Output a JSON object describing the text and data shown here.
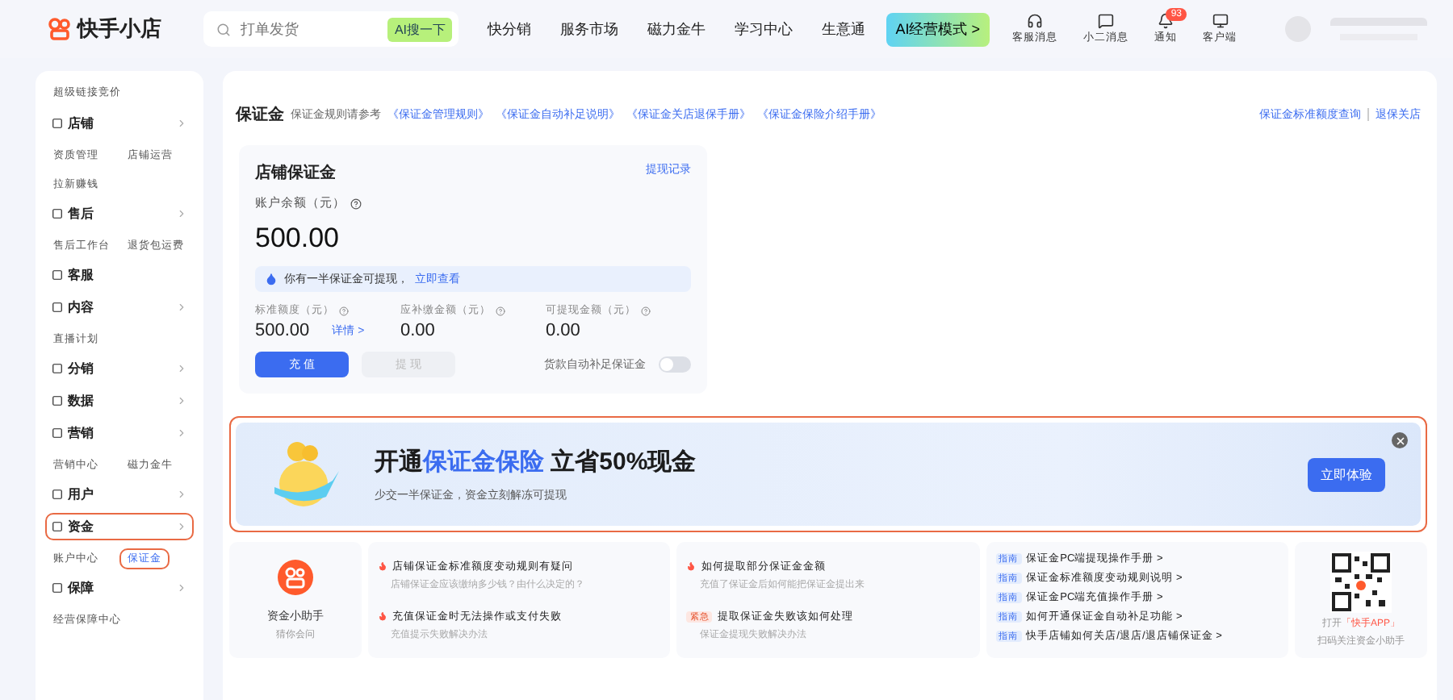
{
  "header": {
    "logo": "快手小店",
    "search": {
      "placeholder": "打单发货",
      "button": "AI搜一下"
    },
    "nav": [
      "快分销",
      "服务市场",
      "磁力金牛",
      "学习中心",
      "生意通"
    ],
    "ai_mode": "AI经营模式 >",
    "tools": [
      {
        "kind": "headset",
        "label": "客服消息"
      },
      {
        "kind": "chat",
        "label": "小二消息"
      },
      {
        "kind": "bell",
        "label": "通知",
        "badge": "93"
      },
      {
        "kind": "monitor",
        "label": "客户端"
      }
    ]
  },
  "sidebar": {
    "top_link": "超级链接竞价",
    "sections": [
      {
        "title": "店铺",
        "highlighted": false,
        "chevron": true,
        "children": [
          {
            "label": "资质管理",
            "selected": false,
            "highlighted": false
          },
          {
            "label": "店铺运营",
            "selected": false,
            "highlighted": false
          },
          {
            "label": "拉新赚钱",
            "selected": false,
            "highlighted": false
          }
        ]
      },
      {
        "title": "售后",
        "highlighted": false,
        "chevron": true,
        "children": [
          {
            "label": "售后工作台",
            "selected": false,
            "highlighted": false
          },
          {
            "label": "退货包运费",
            "selected": false,
            "highlighted": false
          }
        ]
      },
      {
        "title": "客服",
        "highlighted": false,
        "chevron": false
      },
      {
        "title": "内容",
        "highlighted": false,
        "chevron": true,
        "children": [
          {
            "label": "直播计划",
            "selected": false,
            "highlighted": false
          }
        ]
      },
      {
        "title": "分销",
        "highlighted": false,
        "chevron": true
      },
      {
        "title": "数据",
        "highlighted": false,
        "chevron": true
      },
      {
        "title": "营销",
        "highlighted": false,
        "chevron": true,
        "children": [
          {
            "label": "营销中心",
            "selected": false,
            "highlighted": false
          },
          {
            "label": "磁力金牛",
            "selected": false,
            "highlighted": false
          }
        ]
      },
      {
        "title": "用户",
        "highlighted": false,
        "chevron": true
      },
      {
        "title": "资金",
        "highlighted": true,
        "chevron": true,
        "children": [
          {
            "label": "账户中心",
            "selected": false,
            "highlighted": false
          },
          {
            "label": "保证金",
            "selected": true,
            "highlighted": true
          }
        ]
      },
      {
        "title": "保障",
        "highlighted": false,
        "chevron": true,
        "children": [
          {
            "label": "经营保障中心",
            "selected": false,
            "highlighted": false
          }
        ]
      }
    ]
  },
  "page": {
    "title": "保证金",
    "rules_intro": "保证金规则请参考",
    "rule_links": [
      "《保证金管理规则》",
      "《保证金自动补足说明》",
      "《保证金关店退保手册》",
      "《保证金保险介绍手册》"
    ],
    "right_links": [
      "保证金标准额度查询",
      "退保关店"
    ]
  },
  "deposit_card": {
    "title": "店铺保证金",
    "record_link": "提现记录",
    "balance_label": "账户余额（元）",
    "balance": "500.00",
    "notice": "你有一半保证金可提现，",
    "notice_link": "立即查看",
    "stats": [
      {
        "label": "标准额度（元）",
        "value": "500.00",
        "link": "详情 >"
      },
      {
        "label": "应补缴金额（元）",
        "value": "0.00"
      },
      {
        "label": "可提现金额（元）",
        "value": "0.00"
      }
    ],
    "buttons": [
      {
        "label": "充 值",
        "disabled": false
      },
      {
        "label": "提 现",
        "disabled": true
      }
    ],
    "auto_topup": {
      "label": "货款自动补足保证金",
      "on": false
    }
  },
  "banner": {
    "title_before": "开通",
    "title_highlight": "保证金保险",
    "title_after": " 立省50%现金",
    "subtitle": "少交一半保证金，资金立刻解冻可提现",
    "button": "立即体验"
  },
  "helper": {
    "title": "资金小助手",
    "subtitle": "猜你会问",
    "questions": [
      {
        "kind": "hot",
        "title": "店铺保证金标准额度变动规则有疑问",
        "desc": "店铺保证金应该缴纳多少钱？由什么决定的？"
      },
      {
        "kind": "hot",
        "title": "如何提取部分保证金金额",
        "desc": "充值了保证金后如何能把保证金提出来"
      },
      {
        "kind": "hot",
        "title": "充值保证金时无法操作或支付失败",
        "desc": "充值提示失败解决办法"
      },
      {
        "kind": "urgent",
        "tag": "紧急",
        "title": "提取保证金失败该如何处理",
        "desc": "保证金提现失败解决办法"
      }
    ],
    "guides": [
      {
        "tag": "指南",
        "label": "保证金PC端提现操作手册 >"
      },
      {
        "tag": "指南",
        "label": "保证金标准额度变动规则说明 >"
      },
      {
        "tag": "指南",
        "label": "保证金PC端充值操作手册 >"
      },
      {
        "tag": "指南",
        "label": "如何开通保证金自动补足功能 >"
      },
      {
        "tag": "指南",
        "label": "快手店铺如何关店/退店/退店铺保证金 >"
      }
    ],
    "qr": {
      "line1_before": "打开",
      "line1_link": "「快手APP」",
      "line2": "扫码关注资金小助手"
    }
  }
}
